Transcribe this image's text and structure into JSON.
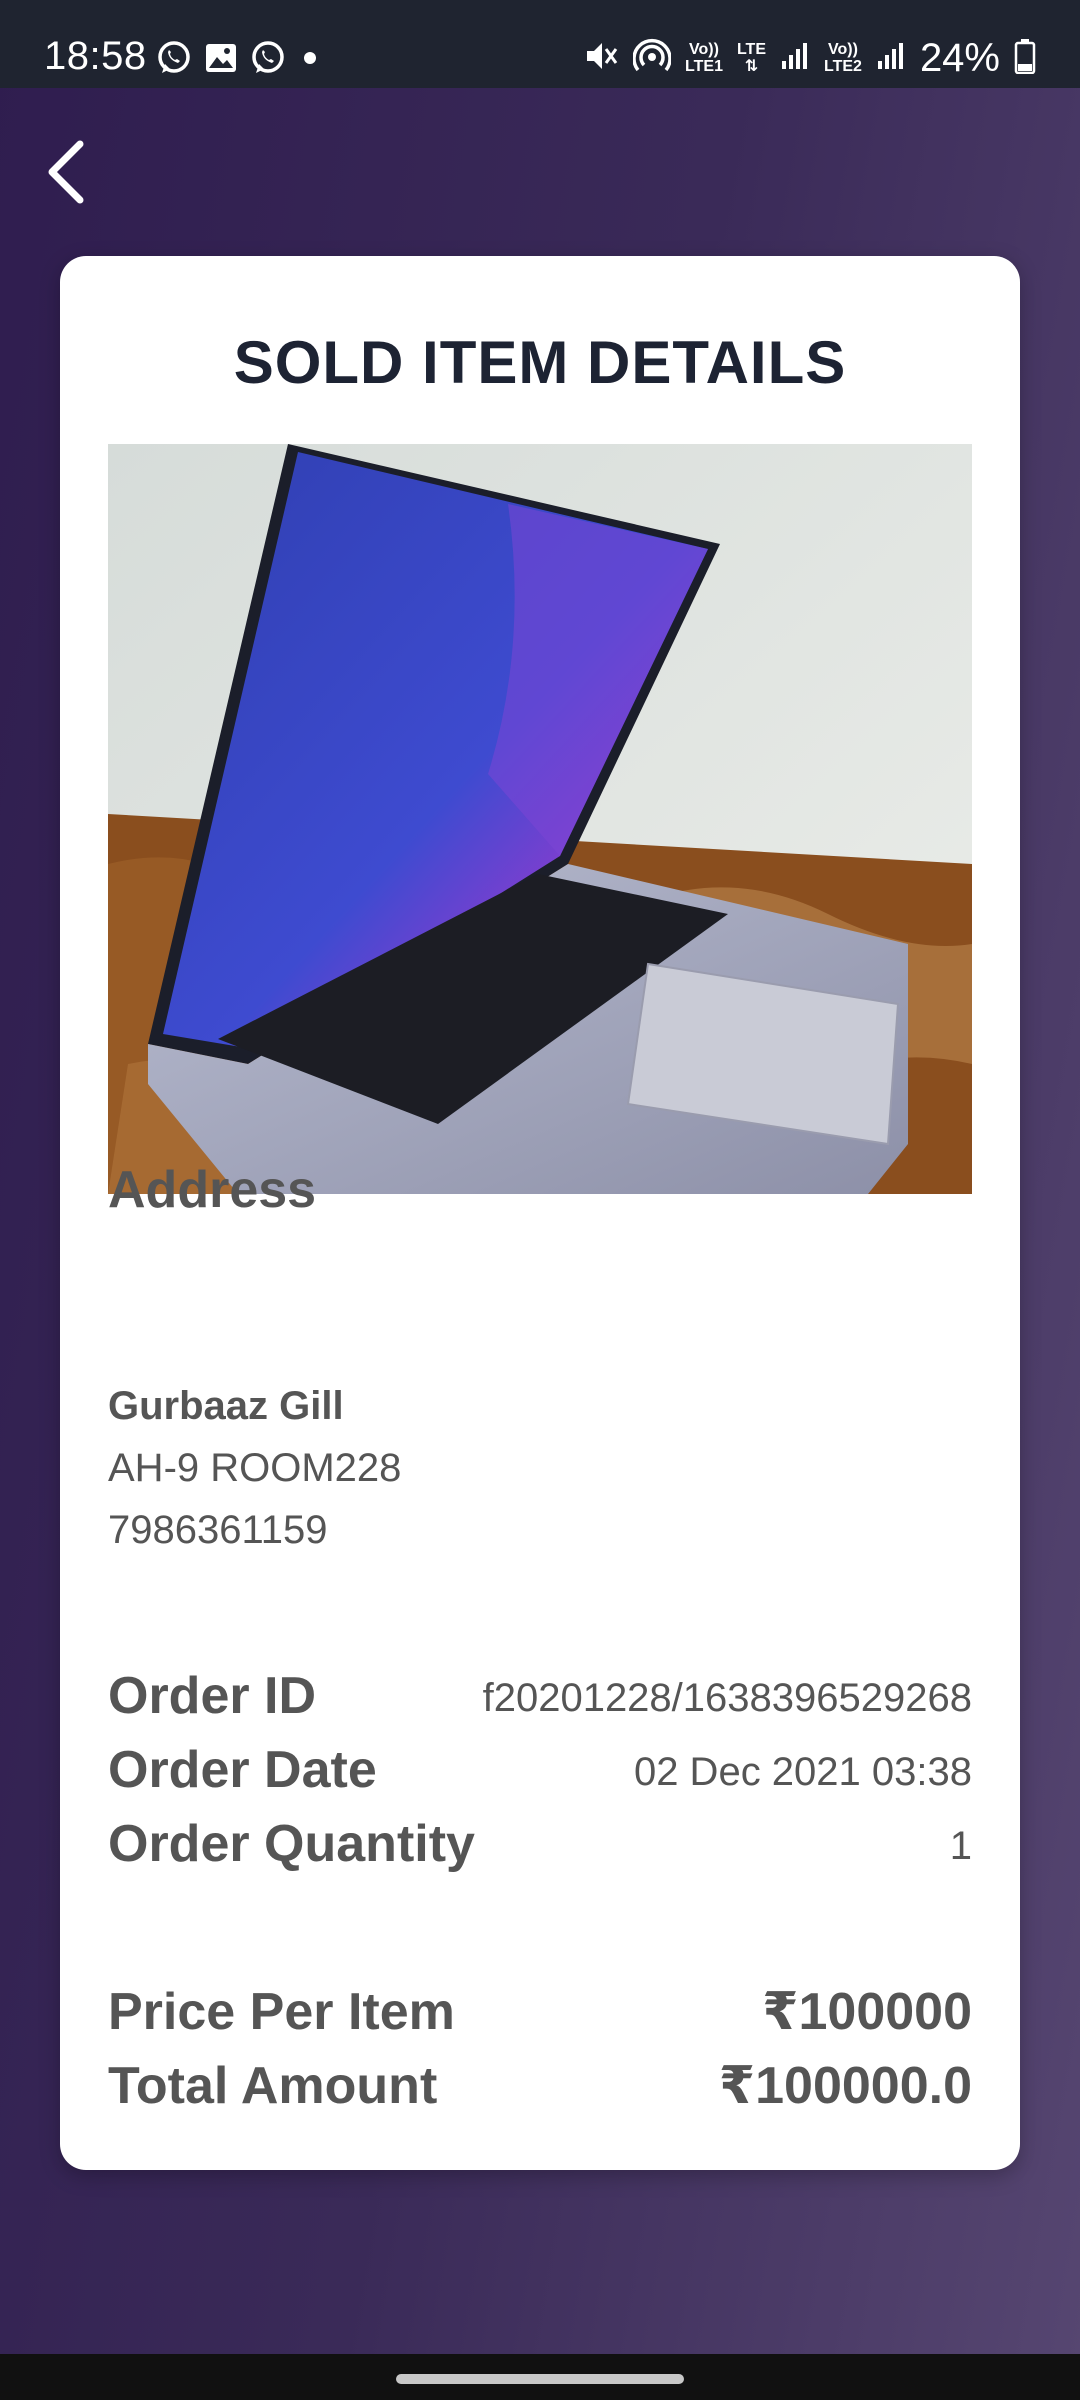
{
  "status_bar": {
    "time": "18:58",
    "battery": "24%",
    "sim1_top": "Vo))",
    "sim1_bottom": "LTE1",
    "lte_label": "LTE",
    "sim2_top": "Vo))",
    "sim2_bottom": "LTE2",
    "icons": [
      "whatsapp-icon",
      "gallery-icon",
      "whatsapp-icon",
      "dot-icon",
      "mute-icon",
      "hotspot-icon",
      "signal-icon",
      "battery-icon"
    ]
  },
  "header": {
    "back_icon": "chevron-left-icon"
  },
  "card": {
    "title": "SOLD ITEM DETAILS",
    "address": {
      "heading": "Address",
      "name": "Gurbaaz Gill",
      "line1": "AH-9 ROOM228",
      "phone": "7986361159"
    },
    "order": {
      "id_label": "Order ID",
      "id_value": "f20201228/1638396529268",
      "date_label": "Order Date",
      "date_value": "02 Dec 2021 03:38",
      "qty_label": "Order Quantity",
      "qty_value": "1"
    },
    "pricing": {
      "price_label": "Price Per Item",
      "price_value": "₹100000",
      "total_label": "Total Amount",
      "total_value": "₹100000.0"
    }
  },
  "colors": {
    "background_start": "#2f1d4f",
    "background_end": "#564671",
    "title": "#1d2333",
    "text": "#555555",
    "card": "#ffffff"
  }
}
